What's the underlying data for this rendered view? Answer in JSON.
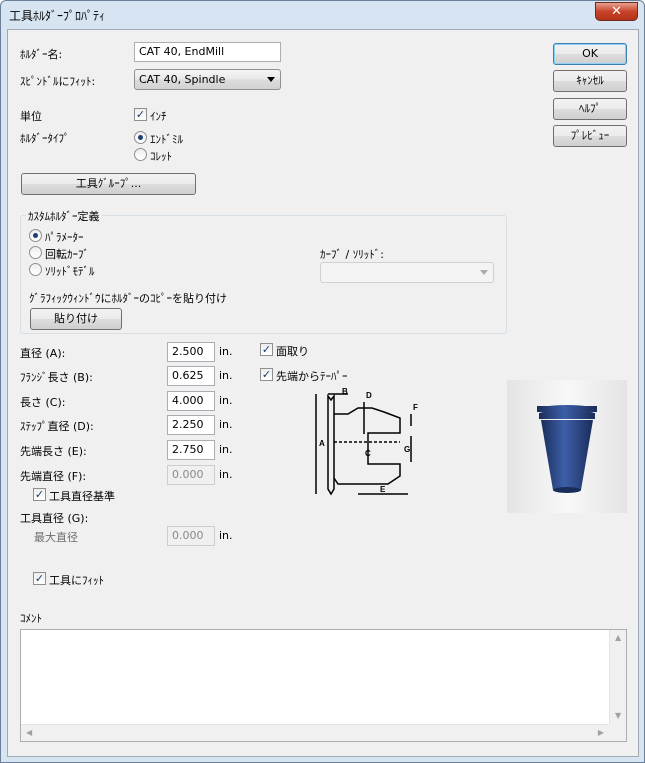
{
  "window": {
    "title": "工具ﾎﾙﾀﾞｰﾌﾟﾛﾊﾟﾃｨ",
    "close_glyph": "✕"
  },
  "form": {
    "holder_name_label": "ﾎﾙﾀﾞｰ名:",
    "holder_name_value": "CAT 40, EndMill",
    "spindle_fit_label": "ｽﾋﾟﾝﾄﾞﾙにﾌｨｯﾄ:",
    "spindle_fit_value": "CAT 40, Spindle",
    "unit_label": "単位",
    "unit_option": "ｲﾝﾁ",
    "holder_type_label": "ﾎﾙﾀﾞｰﾀｲﾌﾟ",
    "holder_type_options": [
      "ｴﾝﾄﾞﾐﾙ",
      "ｺﾚｯﾄ"
    ],
    "tool_group_button": "工具ｸﾞﾙｰﾌﾟ..."
  },
  "side_buttons": {
    "ok": "OK",
    "cancel": "ｷｬﾝｾﾙ",
    "help": "ﾍﾙﾌﾟ",
    "preview": "ﾌﾟﾚﾋﾞｭｰ"
  },
  "custom_holder": {
    "title": "ｶｽﾀﾑﾎﾙﾀﾞｰ定義",
    "options": [
      "ﾊﾟﾗﾒｰﾀｰ",
      "回転ｶｰﾌﾞ",
      "ｿﾘｯﾄﾞﾓﾃﾞﾙ"
    ],
    "curve_solid_label": "ｶｰﾌﾞ / ｿﾘｯﾄﾞ:",
    "curve_solid_value": "",
    "paste_hint": "ｸﾞﾗﾌｨｯｸｳｨﾝﾄﾞｳにﾎﾙﾀﾞｰのｺﾋﾟｰを貼り付け",
    "paste_button": "貼り付け"
  },
  "dimensions": {
    "unit": "in.",
    "rows": [
      {
        "label": "直径 (A):",
        "value": "2.500"
      },
      {
        "label": "ﾌﾗﾝｼﾞ長さ (B):",
        "value": "0.625"
      },
      {
        "label": "長さ (C):",
        "value": "4.000"
      },
      {
        "label": "ｽﾃｯﾌﾟ直径 (D):",
        "value": "2.250"
      },
      {
        "label": "先端長さ (E):",
        "value": "2.750"
      },
      {
        "label": "先端直径 (F):",
        "value": "0.000"
      }
    ],
    "tool_diameter_basis": "工具直径基準",
    "tool_diameter_label": "工具直径 (G):",
    "max_diameter_label": "最大直径",
    "max_diameter_value": "0.000",
    "chamfer": "面取り",
    "taper_from_tip": "先端からﾃｰﾊﾟｰ",
    "fit_to_tool": "工具にﾌｨｯﾄ"
  },
  "diagram_labels": {
    "a": "A",
    "b": "B",
    "c": "C",
    "d": "D",
    "e": "E",
    "f": "F",
    "g": "G"
  },
  "comment": {
    "label": "ｺﾒﾝﾄ",
    "value": ""
  },
  "colors": {
    "holder_blue": "#2c4a86",
    "accent": "#3c7fb1"
  }
}
